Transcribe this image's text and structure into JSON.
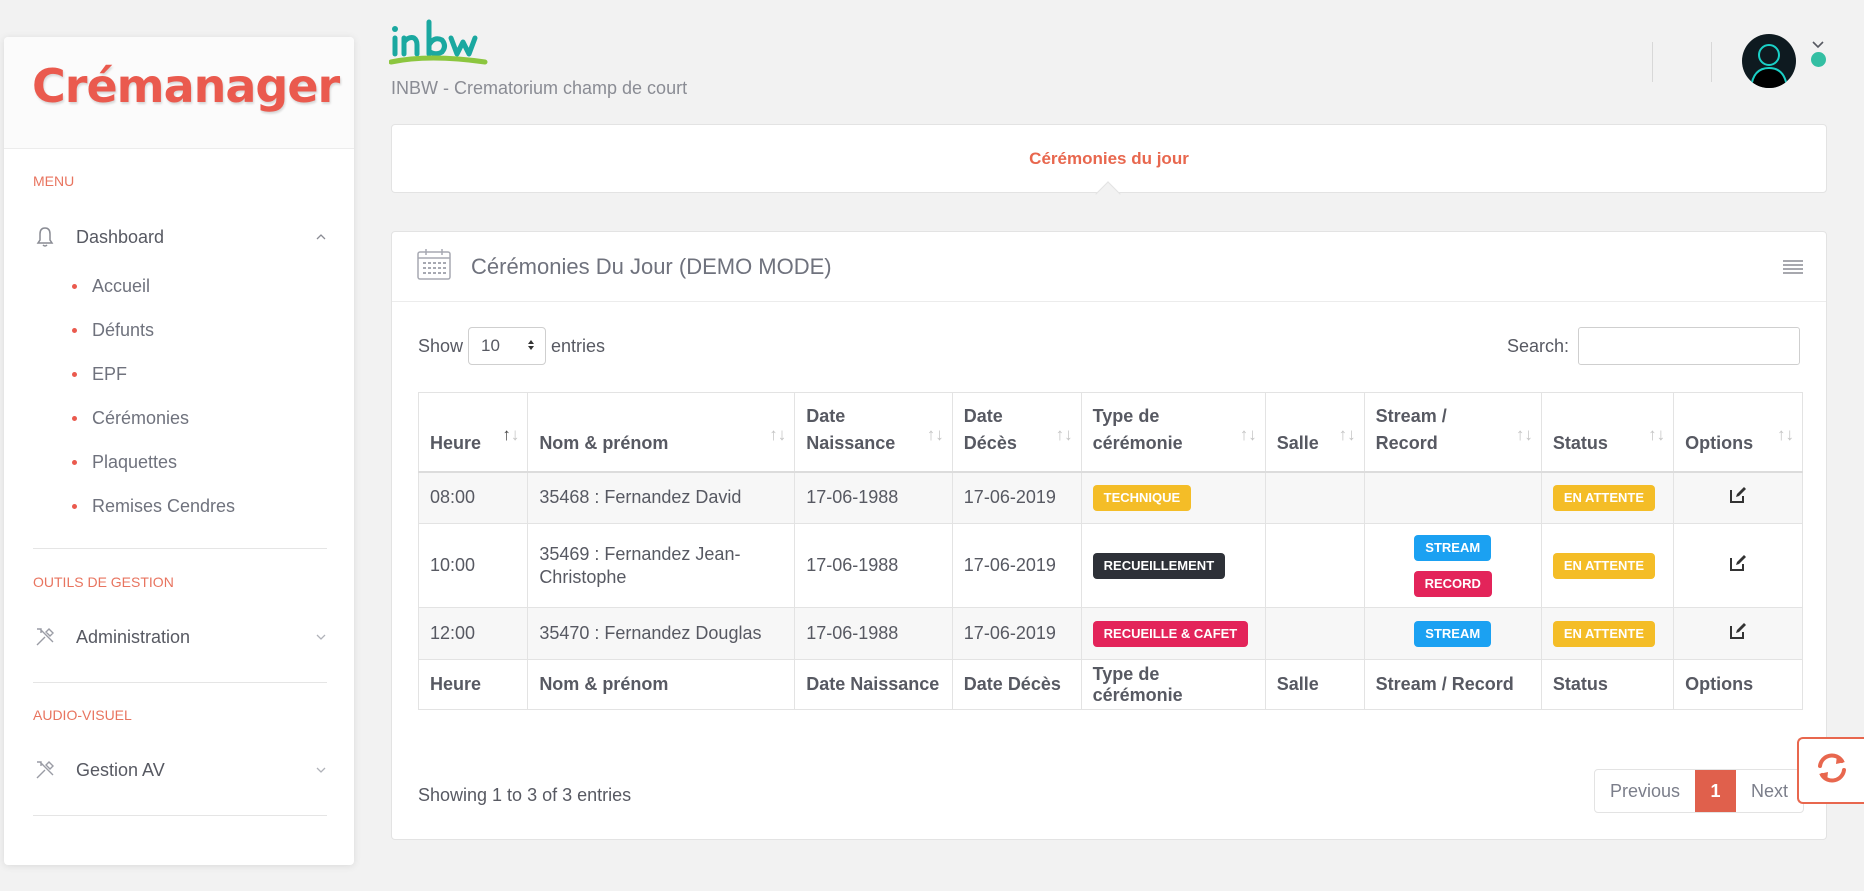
{
  "app": {
    "brand": "Crémanager",
    "logo_text": "inbw",
    "subtitle": "INBW - Crematorium champ de court"
  },
  "sidebar": {
    "menu_title": "MENU",
    "dashboard": {
      "label": "Dashboard",
      "icon": "bell-icon"
    },
    "submenu": [
      "Accueil",
      "Défunts",
      "EPF",
      "Cérémonies",
      "Plaquettes",
      "Remises Cendres"
    ],
    "tools_title": "OUTILS DE GESTION",
    "administration": {
      "label": "Administration",
      "icon": "tools-icon"
    },
    "av_title": "AUDIO-VISUEL",
    "gestion_av": {
      "label": "Gestion AV",
      "icon": "tools-icon"
    }
  },
  "tabs": {
    "active": "Cérémonies du jour"
  },
  "portlet": {
    "title": "Cérémonies Du Jour (DEMO MODE)",
    "show_label": "Show",
    "page_length": "10",
    "entries_label": "entries",
    "search_label": "Search:",
    "search_value": "",
    "columns": [
      [
        "Heure"
      ],
      [
        "Nom & prénom"
      ],
      [
        "Date",
        "Naissance"
      ],
      [
        "Date",
        "Décès"
      ],
      [
        "Type de",
        "cérémonie"
      ],
      [
        "Salle"
      ],
      [
        "Stream / Record"
      ],
      [
        "Status"
      ],
      [
        "Options"
      ]
    ],
    "footer_columns": [
      "Heure",
      "Nom & prénom",
      "Date Naissance",
      "Date Décès",
      "Type de cérémonie",
      "Salle",
      "Stream / Record",
      "Status",
      "Options"
    ],
    "rows": [
      {
        "heure": "08:00",
        "nom": "35468 : Fernandez David",
        "naissance": "17-06-1988",
        "deces": "17-06-2019",
        "type": "TECHNIQUE",
        "type_color": "#f4bd27",
        "salle": "",
        "stream": [],
        "status": "EN ATTENTE"
      },
      {
        "heure": "10:00",
        "nom": "35469 : Fernandez Jean-Christophe",
        "naissance": "17-06-1988",
        "deces": "17-06-2019",
        "type": "RECUEILLEMENT",
        "type_color": "#2e3138",
        "salle": "",
        "stream": [
          "STREAM",
          "RECORD"
        ],
        "status": "EN ATTENTE"
      },
      {
        "heure": "12:00",
        "nom": "35470 : Fernandez Douglas",
        "naissance": "17-06-1988",
        "deces": "17-06-2019",
        "type": "RECUEILLE & CAFET",
        "type_color": "#e3245a",
        "salle": "",
        "stream": [
          "STREAM"
        ],
        "status": "EN ATTENTE"
      }
    ],
    "info": "Showing 1 to 3 of 3 entries",
    "pagination": {
      "previous": "Previous",
      "current": "1",
      "next": "Next"
    }
  },
  "colors": {
    "accent": "#ea5a4e",
    "warning": "#f4bd27",
    "dark": "#2e3138",
    "danger": "#e3245a",
    "info": "#1ba1f2",
    "online": "#34bfa3"
  }
}
